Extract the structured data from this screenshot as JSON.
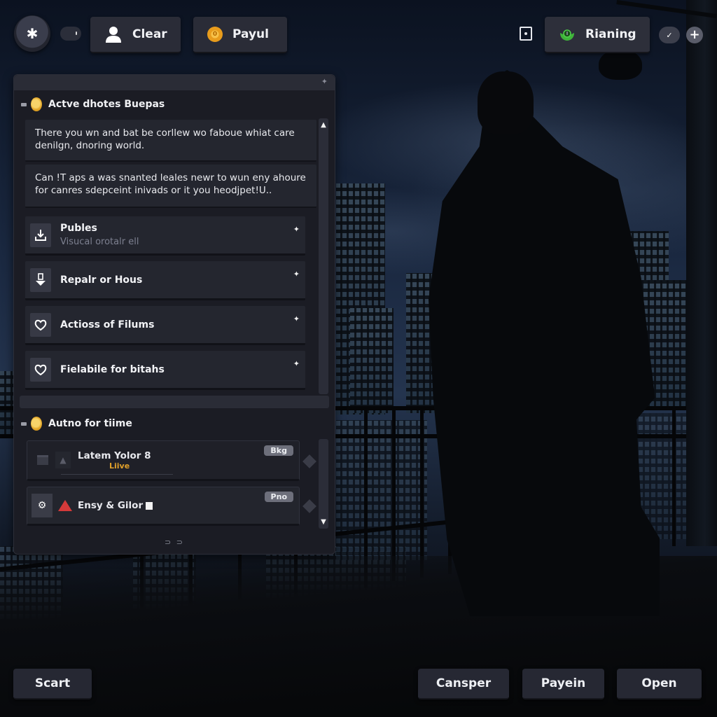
{
  "top_bar": {
    "menu_button_icon": "asterisk-icon",
    "toggle_icon": "toggle-pill-icon",
    "clear_button": {
      "label": "Clear",
      "icon": "user-icon"
    },
    "payul_button": {
      "label": "Payul",
      "icon": "coin-icon"
    },
    "square_icon": "square-dot-icon",
    "status_button": {
      "label": "Rianing",
      "icon": "green-shield-icon"
    },
    "check_icon": "checkmark-icon",
    "plus_icon": "plus-icon"
  },
  "panel": {
    "grip_icon": "move-grip-icon",
    "section1": {
      "title": "Actve dhotes Buepas",
      "messages": [
        {
          "text": "There you wn and bat be corllew wo faboue whiat care denilgn, dnoring world."
        },
        {
          "text": "Can !T aps a was snanted leales newr to wun eny ahoure for canres sdepceint inivads or it you heodjpet!U.."
        }
      ],
      "items": [
        {
          "title": "Publes",
          "subtitle": "Visucal orotalr ell",
          "icon": "download-tray-icon"
        },
        {
          "title": "Repalr or Hous",
          "subtitle": "",
          "icon": "repair-arrow-icon"
        },
        {
          "title": "Actioss of Filums",
          "subtitle": "",
          "icon": "heart-icon"
        },
        {
          "title": "Fielabile for bitahs",
          "subtitle": "",
          "icon": "heart-icon"
        }
      ]
    },
    "section2": {
      "title": "Autno for tiime",
      "cards": [
        {
          "title": "Latem Yolor 8",
          "subtitle": "Liive",
          "badge": "Bkg",
          "icon": "window-icon",
          "icon2": "arrow-up-icon"
        },
        {
          "title": "Ensy & Gilor",
          "subtitle": "",
          "badge": "Pno",
          "icon": "gear-face-icon",
          "icon2": "red-cone-icon"
        }
      ]
    },
    "paging": "⊃ ⊃"
  },
  "bottom_bar": {
    "left_button": "Scart",
    "buttons": [
      "Cansper",
      "Payein",
      "Open"
    ]
  },
  "colors": {
    "panel_bg": "#1b1c24",
    "item_bg": "#24262f",
    "accent_gold": "#e8a62a",
    "accent_green": "#3fb43a",
    "accent_red": "#d43a3a",
    "live_text": "#e0a02a"
  }
}
